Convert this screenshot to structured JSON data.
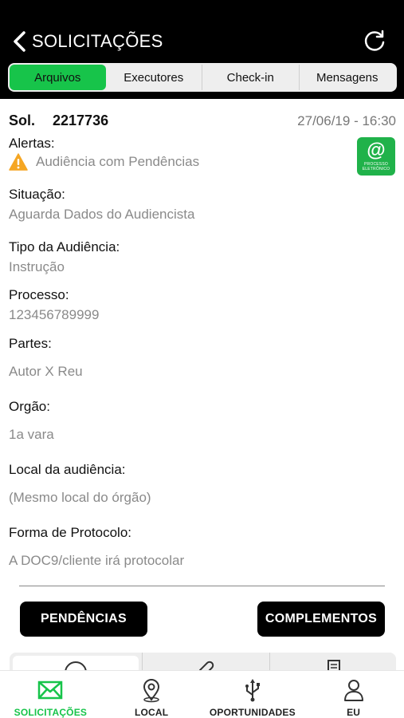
{
  "header": {
    "title": "SOLICITAÇÕES",
    "tabs": [
      "Arquivos",
      "Executores",
      "Check-in",
      "Mensagens"
    ],
    "active_tab": "Arquivos"
  },
  "request": {
    "sol_label": "Sol.",
    "sol_number": "2217736",
    "datetime": "27/06/19 - 16:30",
    "alerts_label": "Alertas:",
    "alert_text": "Audiência com Pendências",
    "badge_symbol": "@",
    "badge_text": "PROCESSO ELETRÔNICO",
    "fields": [
      {
        "label": "Situação:",
        "value": "Aguarda Dados do Audiencista"
      },
      {
        "label": "Tipo da Audiência:",
        "value": "Instrução"
      },
      {
        "label": "Processo:",
        "value": "123456789999"
      },
      {
        "label": "Partes:",
        "value": "Autor X Reu"
      },
      {
        "label": "Orgão:",
        "value": "1a vara"
      },
      {
        "label": "Local da audiência:",
        "value": "(Mesmo local do órgão)"
      },
      {
        "label": "Forma de Protocolo:",
        "value": "A DOC9/cliente irá protocolar"
      }
    ]
  },
  "actions": {
    "pendencias": "PENDÊNCIAS",
    "complementos": "COMPLEMENTOS"
  },
  "subtabs": {
    "icons": [
      "play-icon",
      "paperclip-icon",
      "documents-icon"
    ]
  },
  "bottomnav": {
    "items": [
      {
        "label": "SOLICITAÇÕES",
        "icon": "envelope-icon"
      },
      {
        "label": "LOCAL",
        "icon": "location-pin-icon"
      },
      {
        "label": "OPORTUNIDADES",
        "icon": "usb-icon"
      },
      {
        "label": "EU",
        "icon": "user-icon"
      }
    ],
    "active": "SOLICITAÇÕES"
  },
  "colors": {
    "accent": "#17c44a",
    "badge": "#20b24a",
    "header_bg": "#000000",
    "warning": "#f5a623",
    "muted_text": "#8a8a8a"
  }
}
